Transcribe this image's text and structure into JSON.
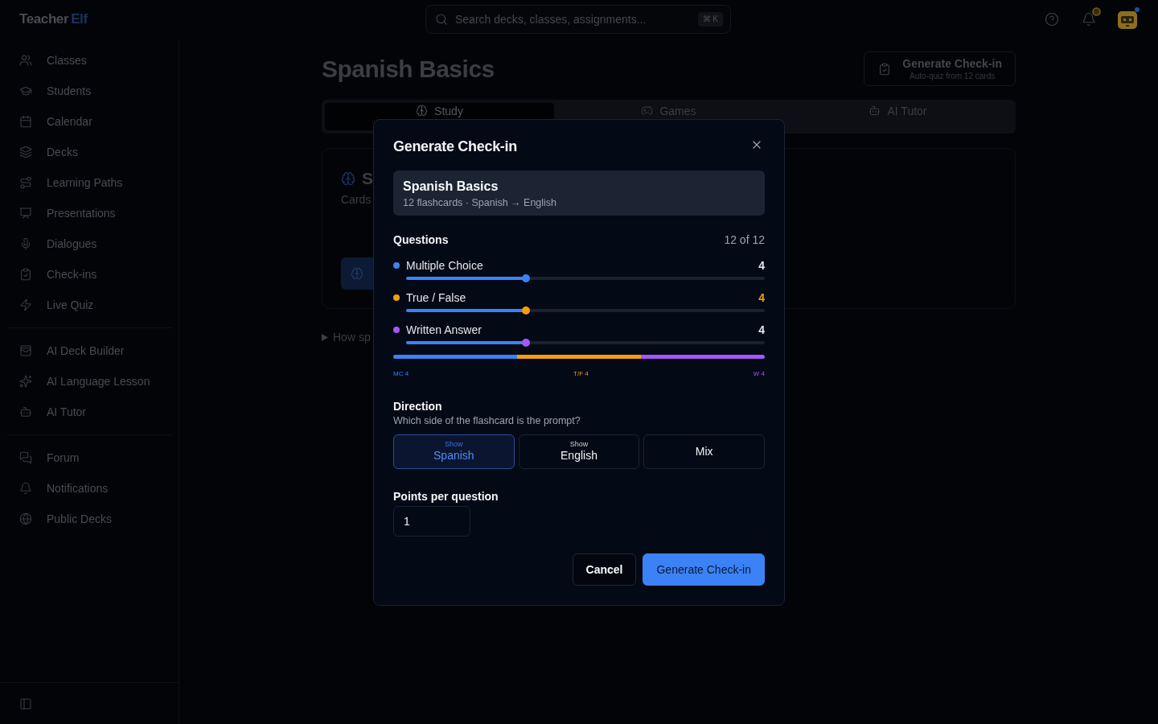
{
  "header": {
    "logo": {
      "word_1": "Teacher",
      "word_2": "Elf"
    },
    "search": {
      "placeholder": "Search decks, classes, assignments...",
      "shortcut": "⌘ K"
    },
    "notifications": {
      "unread": true
    },
    "avatar": {
      "online": true
    }
  },
  "sidebar": {
    "groups": [
      {
        "items": [
          {
            "label": "Classes",
            "selected": false
          },
          {
            "label": "Students",
            "selected": false
          },
          {
            "label": "Calendar",
            "selected": false
          },
          {
            "label": "Decks",
            "selected": false
          },
          {
            "label": "Learning Paths",
            "selected": false
          },
          {
            "label": "Presentations",
            "selected": false
          },
          {
            "label": "Dialogues",
            "selected": false
          },
          {
            "label": "Check-ins",
            "selected": false
          },
          {
            "label": "Live Quiz",
            "selected": false
          }
        ]
      },
      {
        "items": [
          {
            "label": "AI Deck Builder",
            "selected": false
          },
          {
            "label": "AI Language Lesson",
            "selected": false
          },
          {
            "label": "AI Tutor",
            "selected": false
          }
        ]
      },
      {
        "items": [
          {
            "label": "Forum",
            "selected": false
          },
          {
            "label": "Notifications",
            "selected": false
          },
          {
            "label": "Public Decks",
            "selected": false
          }
        ]
      }
    ]
  },
  "page": {
    "title": "Spanish Basics",
    "action": {
      "label": "Generate Check-in",
      "caption": "Auto-quiz from 12 cards"
    },
    "tabs": [
      {
        "label": "Study",
        "selected": true
      },
      {
        "label": "Games",
        "selected": false
      },
      {
        "label": "AI Tutor",
        "selected": false
      }
    ],
    "card": {
      "heading": "S",
      "subtitle": "Cards"
    },
    "disclosure": {
      "label": "How sp",
      "expanded": false
    }
  },
  "dialog": {
    "title": "Generate Check-in",
    "deck": {
      "name": "Spanish Basics",
      "meta": "12 flashcards · Spanish → English"
    },
    "questions": {
      "label": "Questions",
      "total": "12 of 12",
      "items": [
        {
          "label": "Multiple Choice",
          "value": "4",
          "color": "#3b82f6",
          "level": 0.3333,
          "highlighted": false
        },
        {
          "label": "True / False",
          "value": "4",
          "color": "#f59e0b",
          "level": 0.3333,
          "highlighted": true
        },
        {
          "label": "Written Answer",
          "value": "4",
          "color": "#a855f7",
          "level": 0.3333,
          "highlighted": false
        }
      ]
    },
    "distribution": [
      {
        "label": "MC 4",
        "color": "#3b82f6"
      },
      {
        "label": "T/F 4",
        "color": "#f59e0b"
      },
      {
        "label": "W 4",
        "color": "#a855f7"
      }
    ],
    "direction": {
      "label": "Direction",
      "hint": "Which side of the flashcard is the prompt?",
      "options": [
        {
          "caption": "Show",
          "label": "Spanish",
          "selected": true
        },
        {
          "caption": "Show",
          "label": "English",
          "selected": false
        },
        {
          "label": "Mix",
          "selected": false
        }
      ]
    },
    "points": {
      "label": "Points per question",
      "value": "1"
    },
    "buttons": [
      {
        "label": "Cancel",
        "kind": "secondary"
      },
      {
        "label": "Generate Check-in",
        "kind": "primary"
      }
    ]
  }
}
